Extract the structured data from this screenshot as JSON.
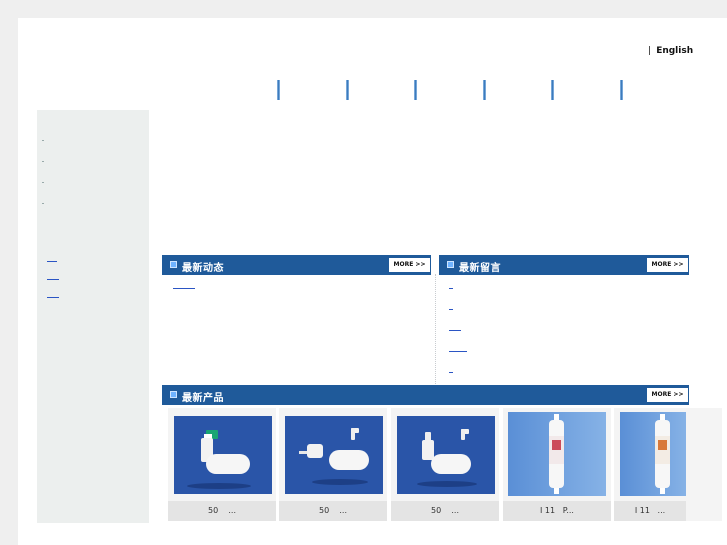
{
  "header": {
    "lang_separator": "|",
    "english_label": "English"
  },
  "panels": {
    "news": {
      "title": "最新动态",
      "more_label": "MORE >>"
    },
    "messages": {
      "title": "最新留言",
      "more_label": "MORE >>"
    },
    "products": {
      "title": "最新产品",
      "more_label": "MORE >>"
    }
  },
  "products": [
    {
      "caption": "50    ...",
      "image": "white-float-valve-green-fitting"
    },
    {
      "caption": "50    ...",
      "image": "white-float-valve-elbow"
    },
    {
      "caption": "50    ...",
      "image": "white-float-valve-elbow"
    },
    {
      "caption": "I 11   P...",
      "image": "inline-water-filter-cartridge"
    },
    {
      "caption": "I 11   ...",
      "image": "inline-water-filter-cartridge"
    }
  ],
  "colors": {
    "header_bar": "#1f5a9a",
    "product_bg": "#2a55a8",
    "link": "#2b55c4",
    "sidebar": "#ecefee"
  }
}
